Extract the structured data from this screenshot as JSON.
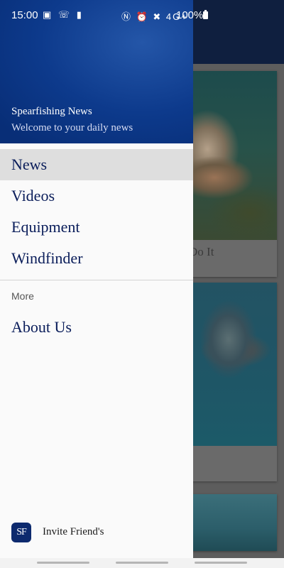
{
  "status_bar": {
    "time": "15:00",
    "left_icons": "▣ ☏ ▮",
    "right_icons": "Ⓝ ⏰ ✖ 4G+",
    "battery": "100%"
  },
  "drawer": {
    "title": "Spearfishing News",
    "subtitle": "Welcome to your daily news",
    "items": [
      {
        "label": "News",
        "active": true
      },
      {
        "label": "Videos"
      },
      {
        "label": "Equipment"
      },
      {
        "label": "Windfinder"
      }
    ],
    "section_label": "More",
    "more_items": [
      {
        "label": "About Us"
      }
    ],
    "footer": {
      "logo_text": "SF",
      "invite_label": "Invite Friend's"
    }
  },
  "background": {
    "card1_caption": "Do It"
  },
  "colors": {
    "header_blue": "#0d3a8c",
    "menu_text": "#0a1d5a",
    "active_bg": "#dedede"
  }
}
